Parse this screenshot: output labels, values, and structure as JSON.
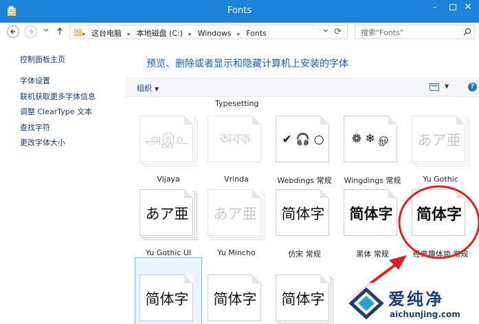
{
  "window": {
    "title": "Fonts"
  },
  "address": {
    "crumbs": [
      "这台电脑",
      "本地磁盘 (C:)",
      "Windows",
      "Fonts"
    ],
    "search_placeholder": "搜索\"Fonts\""
  },
  "sidebar": {
    "home": "控制面板主页",
    "items": [
      {
        "label": "字体设置"
      },
      {
        "label": "联机获取更多字体信息"
      },
      {
        "label": "调整 ClearType 文本"
      },
      {
        "label": "查找字符"
      },
      {
        "label": "更改字体大小"
      }
    ]
  },
  "main": {
    "heading": "预览、删除或者显示和隐藏计算机上安装的字体",
    "organize": "组织",
    "cut_label": "Typesetting",
    "fonts": [
      {
        "name": "Vijaya",
        "sample": "அஇஉ",
        "faded": true
      },
      {
        "name": "Vrinda",
        "sample": "অবক",
        "faded": true
      },
      {
        "name": "Webdings 常规",
        "sample": "✔ 🎧 ○",
        "faded": false
      },
      {
        "name": "Wingdings 常规",
        "sample": "❁ ❄ ௐ",
        "faded": false
      },
      {
        "name": "Yu Gothic",
        "sample": "あア亜",
        "faded": true
      },
      {
        "name": "Yu Gothic UI",
        "sample": "あア亜",
        "faded": false
      },
      {
        "name": "Yu Mincho",
        "sample": "あア亜",
        "faded": true
      },
      {
        "name": "仿宋 常规",
        "sample": "简体字",
        "faded": false
      },
      {
        "name": "黑体 常规",
        "sample": "简体字",
        "faded": false
      },
      {
        "name": "经典趣体简 常规",
        "sample": "简体字",
        "faded": false
      },
      {
        "name": "",
        "sample": "简体字",
        "faded": false
      },
      {
        "name": "",
        "sample": "简体字",
        "faded": false
      },
      {
        "name": "",
        "sample": "简体字",
        "faded": false
      }
    ]
  },
  "watermark": {
    "text": "爱纯净",
    "url": "aichunjing.com"
  },
  "colors": {
    "titlebar": "#1b84d8",
    "heading": "#1e5ab8",
    "annotation": "#e02020"
  }
}
